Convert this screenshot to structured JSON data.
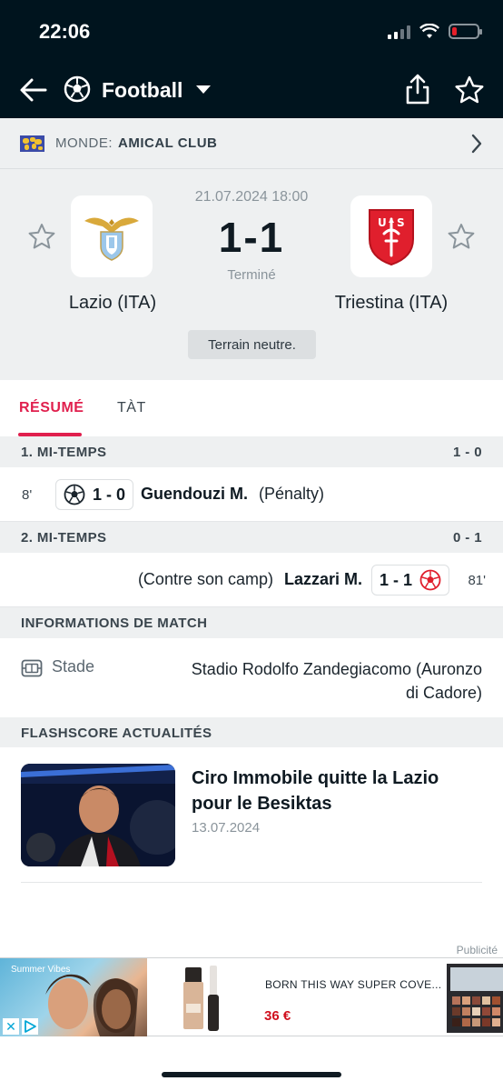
{
  "status_bar": {
    "time": "22:06"
  },
  "header": {
    "sport_title": "Football"
  },
  "league": {
    "country": "MONDE:",
    "name": "AMICAL CLUB"
  },
  "match": {
    "date": "21.07.2024 18:00",
    "score": "1-1",
    "status": "Terminé",
    "venue_note": "Terrain neutre.",
    "home_team": "Lazio (ITA)",
    "away_team": "Triestina (ITA)"
  },
  "tabs": [
    {
      "label": "RÉSUMÉ",
      "active": true
    },
    {
      "label": "TÀT",
      "active": false
    }
  ],
  "periods": [
    {
      "label": "1. MI-TEMPS",
      "score": "1 - 0"
    },
    {
      "label": "2. MI-TEMPS",
      "score": "0 - 1"
    }
  ],
  "events": [
    {
      "minute": "8'",
      "score": "1 - 0",
      "player": "Guendouzi M.",
      "detail": "(Pénalty)",
      "side": "home"
    },
    {
      "minute": "81'",
      "score": "1 - 1",
      "player": "Lazzari M.",
      "detail": "(Contre son camp)",
      "side": "away"
    }
  ],
  "match_info": {
    "heading": "INFORMATIONS DE MATCH",
    "stadium_label": "Stade",
    "stadium_line1": "Stadio Rodolfo Zandegiacomo (Auronzo",
    "stadium_line2": "di Cadore)"
  },
  "news": {
    "heading": "FLASHSCORE ACTUALITÉS",
    "title": "Ciro Immobile quitte la Lazio pour le Besiktas",
    "date": "13.07.2024"
  },
  "ad": {
    "label": "Publicité",
    "tagline": "Summer Vibes",
    "product": "BORN THIS WAY SUPER COVE...",
    "price": "36 €"
  },
  "colors": {
    "header_bg": "#00141e",
    "accent": "#e01f4d",
    "panel_bg": "#eef0f1"
  }
}
